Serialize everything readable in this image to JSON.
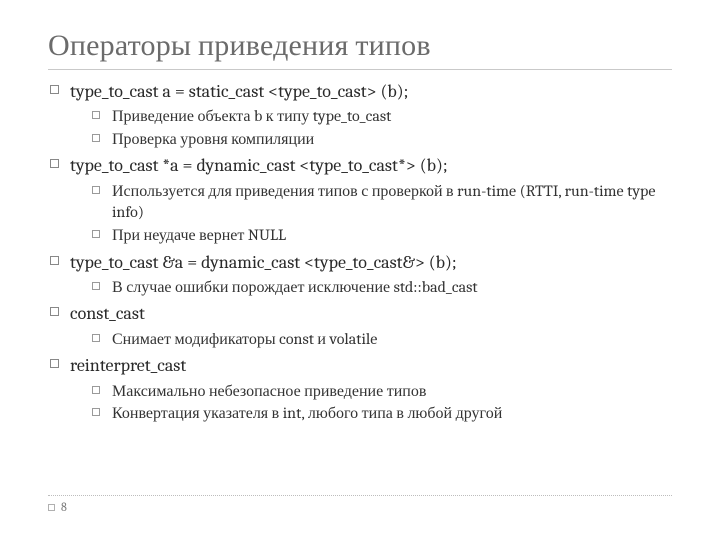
{
  "title": "Операторы приведения типов",
  "pageNumber": "8",
  "items": [
    {
      "text": "type_to_cast  a = static_cast <type_to_cast> (b);",
      "sub": [
        "Приведение объекта b к типу type_to_cast",
        "Проверка уровня компиляции"
      ]
    },
    {
      "text": "type_to_cast  *a = dynamic_cast <type_to_cast*> (b);",
      "sub": [
        "Используется для приведения типов с проверкой в run-time (RTTI, run-time type info)",
        "При неудаче вернет NULL"
      ]
    },
    {
      "text": "type_to_cast  &a = dynamic_cast <type_to_cast&> (b);",
      "sub": [
        "В случае ошибки порождает исключение std::bad_cast"
      ]
    },
    {
      "text": "const_cast",
      "sub": [
        "Снимает модификаторы const и volatile"
      ]
    },
    {
      "text": "reinterpret_cast",
      "sub": [
        "Максимально небезопасное приведение типов",
        "Конвертация указателя в int, любого типа в любой другой"
      ]
    }
  ]
}
